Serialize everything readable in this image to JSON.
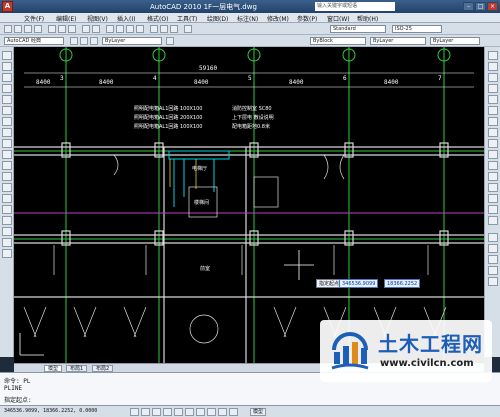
{
  "titlebar": {
    "title": "AutoCAD 2010  1F一层电气.dwg",
    "search_placeholder": "输入关键字或短语",
    "logo": "A"
  },
  "menubar": {
    "items": [
      "文件(F)",
      "编辑(E)",
      "视图(V)",
      "插入(I)",
      "格式(O)",
      "工具(T)",
      "绘图(D)",
      "标注(N)",
      "修改(M)",
      "参数(P)",
      "窗口(W)",
      "帮助(H)"
    ]
  },
  "toolbar1": {
    "style_combo": "Standard",
    "dimstyle_combo": "ISO-25"
  },
  "toolbar2": {
    "workspace_combo": "AutoCAD 经典",
    "layer_combo": "ByLayer",
    "color_combo": "ByBlock",
    "linetype_combo": "ByLayer",
    "lineweight_combo": "ByLayer"
  },
  "drawing": {
    "grid_labels": [
      "3",
      "4",
      "5",
      "6",
      "7"
    ],
    "dims": {
      "total": "59160",
      "d1": "8400",
      "d2": "8400",
      "d3": "8400",
      "d4": "8400",
      "d5": "8400"
    },
    "notes_left": [
      "照明配电箱AL1回路 100X100",
      "照明配电箱AL1回路 200X100",
      "照明配电箱AL1回路 100X100"
    ],
    "notes_right": [
      "消防控制室 SC80",
      "上下层电 敷设说明",
      "配电箱距地0.8米"
    ],
    "room_labels": [
      "电梯厅",
      "楼梯间",
      "前室"
    ]
  },
  "command_tip": {
    "label": "指定起点",
    "x_value": "346536.9099",
    "y_value": "18366.2252"
  },
  "tabs": [
    "模型",
    "布局1",
    "布局2"
  ],
  "cmdline": {
    "line1": "命令: PL",
    "line2": "PLINE",
    "line3": "指定起点:"
  },
  "statusbar": {
    "coords": "346536.9099, 18366.2252, 0.0000",
    "model_label": "模型"
  },
  "watermark": {
    "title": "土木工程网",
    "url": "www.civilcn.com"
  }
}
